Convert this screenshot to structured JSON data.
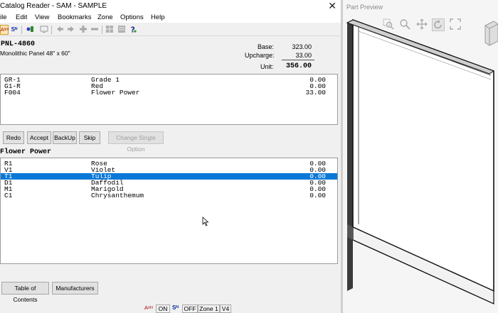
{
  "window": {
    "title": "Catalog Reader - SAM - SAMPLE",
    "close_glyph": "✕"
  },
  "menu": [
    "ile",
    "Edit",
    "View",
    "Bookmarks",
    "Zone",
    "Options",
    "Help"
  ],
  "toolbar": {
    "auto_label": "Aᵃᵗᵒ",
    "sn_label": "Sᴺ",
    "icons": [
      "tool-icon",
      "monitor-icon",
      "arrow-left-icon",
      "arrow-right-icon",
      "plus-icon",
      "minus-icon",
      "grid-icon",
      "list-icon",
      "help-icon"
    ]
  },
  "part": {
    "code": "PNL-4860",
    "description": "Monolithic Panel 48\" x 60\"",
    "base_label": "Base:",
    "base_value": "323.00",
    "upcharge_label": "Upcharge:",
    "upcharge_value": "33.00",
    "unit_label": "Unit:",
    "unit_value": "356.00"
  },
  "selections": [
    {
      "code": "GR-1",
      "name": "Grade 1",
      "price": "0.00"
    },
    {
      "code": "G1-R",
      "name": "Red",
      "price": "0.00"
    },
    {
      "code": "F004",
      "name": "Flower Power",
      "price": "33.00"
    }
  ],
  "buttons": {
    "redo": "Redo",
    "accept": "Accept",
    "backup": "BackUp",
    "skip": "Skip",
    "change_single": "Change Single Option",
    "toc": "Table of Contents",
    "manufacturers": "Manufacturers"
  },
  "option_group": {
    "title": "Flower Power",
    "items": [
      {
        "code": "R1",
        "name": "Rose",
        "price": "0.00",
        "selected": false
      },
      {
        "code": "V1",
        "name": "Violet",
        "price": "0.00",
        "selected": false
      },
      {
        "code": "T1",
        "name": "Tulip",
        "price": "0.00",
        "selected": true
      },
      {
        "code": "D1",
        "name": "Daffodil",
        "price": "0.00",
        "selected": false
      },
      {
        "code": "M1",
        "name": "Marigold",
        "price": "0.00",
        "selected": false
      },
      {
        "code": "C1",
        "name": "Chrysanthemum",
        "price": "0.00",
        "selected": false
      }
    ]
  },
  "status": {
    "auto_icon": "Aᵃᵗᵒ",
    "auto_state": "ON",
    "sn_icon": "Sᴺ",
    "sn_state": "OFF",
    "zone": "Zone 1",
    "version": "V4"
  },
  "preview": {
    "title": "Part Preview",
    "tools": [
      "zoom-box-icon",
      "zoom-icon",
      "pan-icon",
      "rotate-icon",
      "fit-icon"
    ]
  },
  "colors": {
    "selection": "#0a78d7",
    "background": "#f0f0f0",
    "panel_edge": "#000000"
  }
}
